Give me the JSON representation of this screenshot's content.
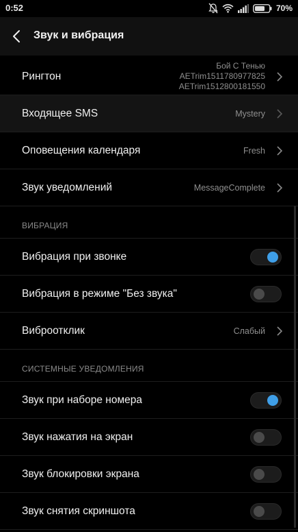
{
  "status_bar": {
    "time": "0:52",
    "battery": "70%",
    "icons": [
      "bell-muted-icon",
      "wifi-icon",
      "signal-icon",
      "battery-icon"
    ]
  },
  "app_bar": {
    "title": "Звук и вибрация"
  },
  "rows": {
    "ringtone": {
      "label": "Рингтон",
      "value_lines": [
        "Бой С Тенью",
        "AETrim1511780977825",
        "AETrim1512800181550"
      ]
    },
    "incoming_sms": {
      "label": "Входящее SMS",
      "value": "Mystery"
    },
    "calendar": {
      "label": "Оповещения календаря",
      "value": "Fresh"
    },
    "notification_sound": {
      "label": "Звук уведомлений",
      "value": "MessageComplete"
    }
  },
  "section_vibration": {
    "title": "ВИБРАЦИЯ",
    "items": [
      {
        "label": "Вибрация при звонке",
        "on": true
      },
      {
        "label": "Вибрация в режиме \"Без звука\"",
        "on": false
      }
    ],
    "haptic": {
      "label": "Виброотклик",
      "value": "Слабый"
    }
  },
  "section_system": {
    "title": "СИСТЕМНЫЕ УВЕДОМЛЕНИЯ",
    "items": [
      {
        "label": "Звук при наборе номера",
        "on": true
      },
      {
        "label": "Звук нажатия на экран",
        "on": false
      },
      {
        "label": "Звук блокировки экрана",
        "on": false
      },
      {
        "label": "Звук снятия скриншота",
        "on": false
      }
    ]
  },
  "colors": {
    "accent": "#3f9fe8",
    "background": "#000000",
    "secondary_text": "#8f8f8f"
  }
}
